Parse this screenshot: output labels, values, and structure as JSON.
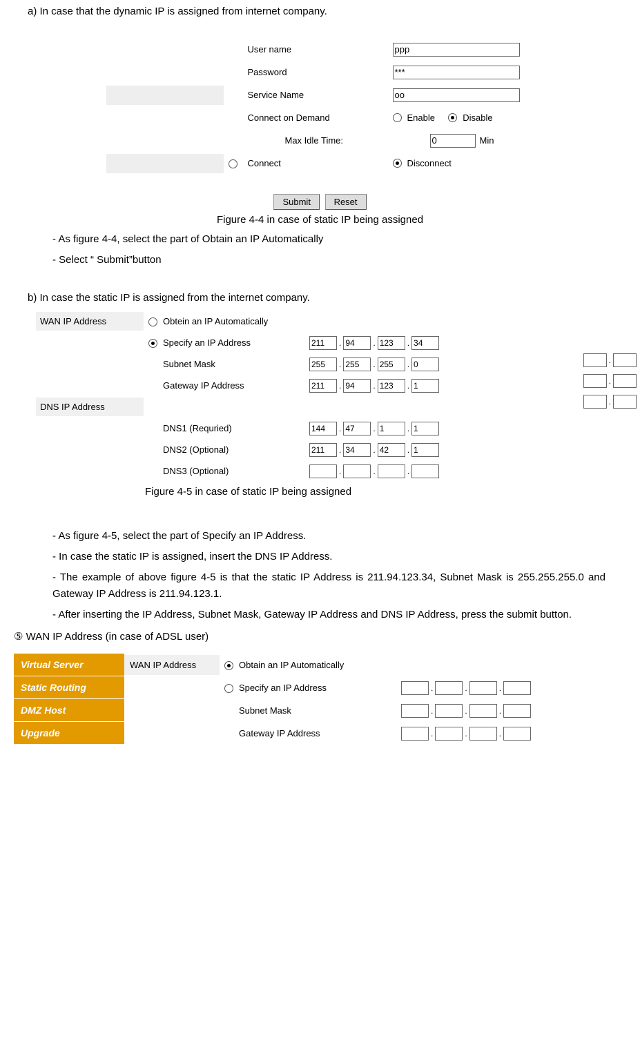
{
  "heading_a": "a) In case that the dynamic IP is assigned from internet company.",
  "fig44": {
    "rows": {
      "username_label": "User name",
      "username_value": "ppp",
      "password_label": "Password",
      "password_value": "***",
      "service_label": "Service Name",
      "service_value": "oo",
      "cod_label": "Connect on Demand",
      "enable": "Enable",
      "disable": "Disable",
      "maxidle_label": "Max Idle Time:",
      "maxidle_value": "0",
      "maxidle_unit": "Min",
      "connect": "Connect",
      "disconnect": "Disconnect"
    },
    "submit": "Submit",
    "reset": "Reset"
  },
  "fig44_caption": "Figure 4-4 in case of static IP being assigned",
  "bullets_a": {
    "b1": "- As figure 4-4, select the part of Obtain an IP Automatically",
    "b2": "- Select  “ Submit”button"
  },
  "heading_b": "b) In case the static IP is assigned from the internet company.",
  "fig45": {
    "wan_label": "WAN IP Address",
    "obtain": "Obtein an IP Automatically",
    "specify": "Specify an IP Address",
    "specify_ip": [
      "211",
      "94",
      "123",
      "34"
    ],
    "subnet_label": "Subnet Mask",
    "subnet": [
      "255",
      "255",
      "255",
      "0"
    ],
    "gateway_label": "Gateway IP Address",
    "gateway": [
      "211",
      "94",
      "123",
      "1"
    ],
    "dns_label": "DNS IP Address",
    "dns1_label": "DNS1 (Requried)",
    "dns1": [
      "144",
      "47",
      "1",
      "1"
    ],
    "dns2_label": "DNS2 (Optional)",
    "dns2": [
      "211",
      "34",
      "42",
      "1"
    ],
    "dns3_label": "DNS3 (Optional)",
    "dns3": [
      "",
      "",
      "",
      ""
    ]
  },
  "fig45_caption": "Figure 4-5 in case of static IP being assigned",
  "bullets_b": {
    "b1": "- As figure 4-5, select the part of Specify an IP Address.",
    "b2": "- In case the static IP is assigned, insert the DNS IP Address.",
    "b3": "- The example of above figure 4-5 is that the static IP Address is 211.94.123.34, Subnet Mask is 255.255.255.0 and Gateway IP Address is 211.94.123.1.",
    "b4": "- After inserting the IP Address, Subnet Mask, Gateway IP Address and DNS IP Address, press the submit button."
  },
  "section5_heading": "⑤ WAN IP Address (in case of ADSL user)",
  "fig46": {
    "side": [
      "Virtual Server",
      "Static Routing",
      "DMZ Host",
      "Upgrade"
    ],
    "wan_label": "WAN IP Address",
    "obtain": "Obtain an IP Automatically",
    "specify": "Specify an IP Address",
    "subnet": "Subnet Mask",
    "gateway": "Gateway IP Address"
  },
  "dot": "."
}
